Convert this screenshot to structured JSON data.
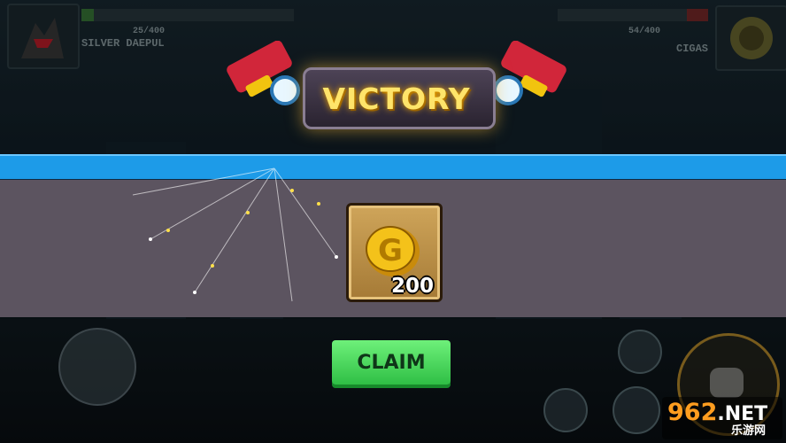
{
  "hud": {
    "left": {
      "hp": "25/400",
      "name": "SILVER DAEPUL",
      "hp_color": "#3a7a3a"
    },
    "right": {
      "hp": "54/400",
      "name": "CIGAS",
      "hp_color": "#7a2a2a"
    }
  },
  "banner": {
    "title": "VICTORY"
  },
  "reward": {
    "icon": "gold-coin-icon",
    "amount": "200"
  },
  "claim": {
    "label": "CLAIM"
  },
  "watermark": {
    "number": "962",
    "tld": ".NET",
    "sub": "乐游网"
  },
  "colors": {
    "panel_top": "#1d9be8",
    "panel": "#5c5460",
    "claim": "#3fd455",
    "coin": "#f4c21a"
  }
}
